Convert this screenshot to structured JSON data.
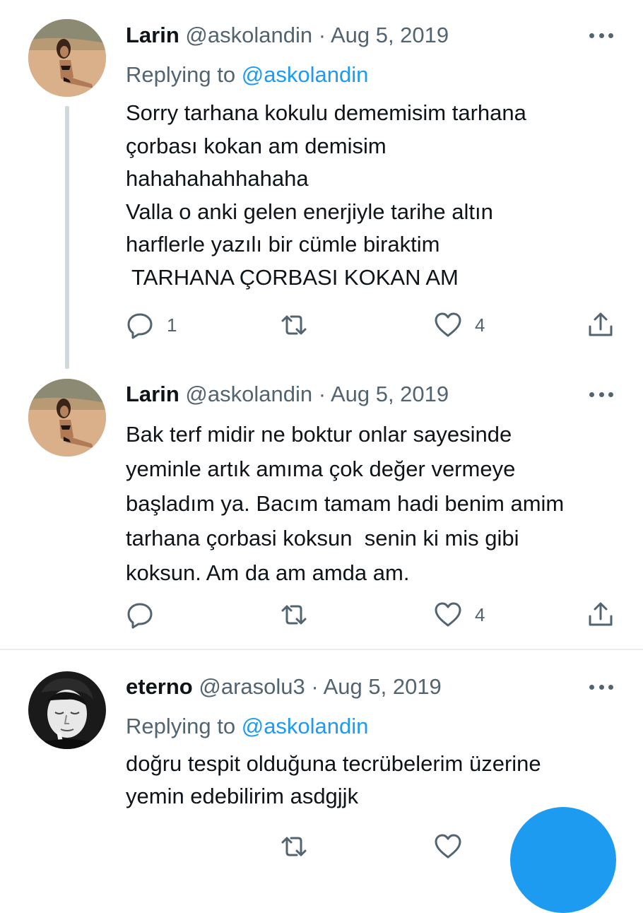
{
  "tweets": [
    {
      "name": "Larin",
      "meta": "@askolandin · Aug 5, 2019",
      "replying_prefix": "Replying to ",
      "replying_handle": "@askolandin",
      "lines": [
        "Sorry tarhana kokulu dememisim tarhana",
        "çorbası kokan am demisim",
        "hahahahahhahaha",
        "Valla o anki gelen enerjiyle tarihe altın",
        "harflerle yazılı bir cümle biraktim",
        " TARHANA ÇORBASI KOKAN AM"
      ],
      "reply_count": "1",
      "retweet_count": "",
      "like_count": "4"
    },
    {
      "name": "Larin",
      "meta": "@askolandin · Aug 5, 2019",
      "lines": [
        "Bak terf midir ne boktur onlar sayesinde",
        "yeminle artık amıma çok değer vermeye",
        "başladım ya. Bacım tamam hadi benim amim",
        "tarhana çorbasi koksun  senin ki mis gibi",
        "koksun. Am da am amda am."
      ],
      "reply_count": "",
      "retweet_count": "",
      "like_count": "4"
    },
    {
      "name": "eterno",
      "meta": "@arasolu3 · Aug 5, 2019",
      "replying_prefix": "Replying to ",
      "replying_handle": "@askolandin",
      "lines": [
        "doğru tespit olduğuna tecrübelerim üzerine",
        "yemin edebilirim asdgjjk"
      ]
    }
  ],
  "icons": {
    "reply": "reply-icon",
    "retweet": "retweet-icon",
    "like": "heart-icon",
    "share": "share-icon",
    "more": "more-icon",
    "compose": "compose-fab"
  },
  "colors": {
    "accent": "#1d9bf0",
    "text": "#0f1419",
    "secondary": "#536471",
    "divider": "#e6ecf0",
    "thread_line": "#cfd9de"
  }
}
